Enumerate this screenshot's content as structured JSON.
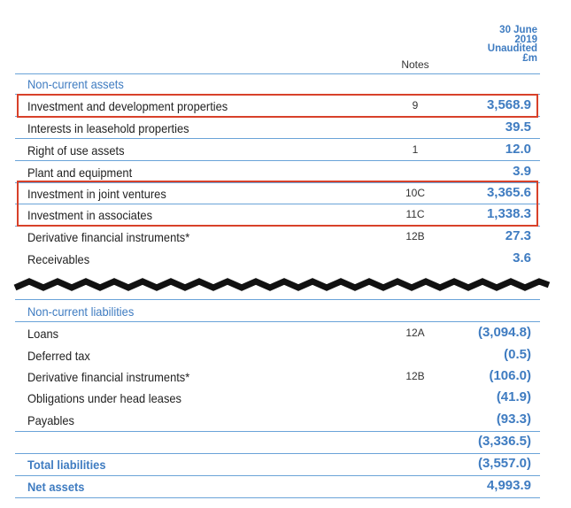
{
  "header": {
    "period_lines": [
      "30 June",
      "2019",
      "Unaudited",
      "£m"
    ],
    "notes_label": "Notes"
  },
  "assets": {
    "section_title": "Non-current assets",
    "rows": [
      {
        "label": "Investment and development properties",
        "note": "9",
        "value": "3,568.9"
      },
      {
        "label": "Interests in leasehold properties",
        "note": "",
        "value": "39.5"
      },
      {
        "label": "Right of use assets",
        "note": "1",
        "value": "12.0"
      },
      {
        "label": "Plant and equipment",
        "note": "",
        "value": "3.9"
      },
      {
        "label": "Investment in joint ventures",
        "note": "10C",
        "value": "3,365.6"
      },
      {
        "label": "Investment in associates",
        "note": "11C",
        "value": "1,338.3"
      },
      {
        "label": "Derivative financial instruments*",
        "note": "12B",
        "value": "27.3"
      },
      {
        "label": "Receivables",
        "note": "",
        "value": "3.6"
      }
    ]
  },
  "liabilities": {
    "section_title": "Non-current liabilities",
    "rows": [
      {
        "label": "Loans",
        "note": "12A",
        "value": "(3,094.8)"
      },
      {
        "label": "Deferred tax",
        "note": "",
        "value": "(0.5)"
      },
      {
        "label": "Derivative financial instruments*",
        "note": "12B",
        "value": "(106.0)"
      },
      {
        "label": "Obligations under head leases",
        "note": "",
        "value": "(41.9)"
      },
      {
        "label": "Payables",
        "note": "",
        "value": "(93.3)"
      }
    ],
    "subtotal": "(3,336.5)"
  },
  "totals": {
    "total_liabilities_label": "Total liabilities",
    "total_liabilities_value": "(3,557.0)",
    "net_assets_label": "Net assets",
    "net_assets_value": "4,993.9"
  },
  "colors": {
    "accent": "#3f7cc1",
    "highlight": "#d8412a",
    "rule": "#6aa3d8"
  }
}
